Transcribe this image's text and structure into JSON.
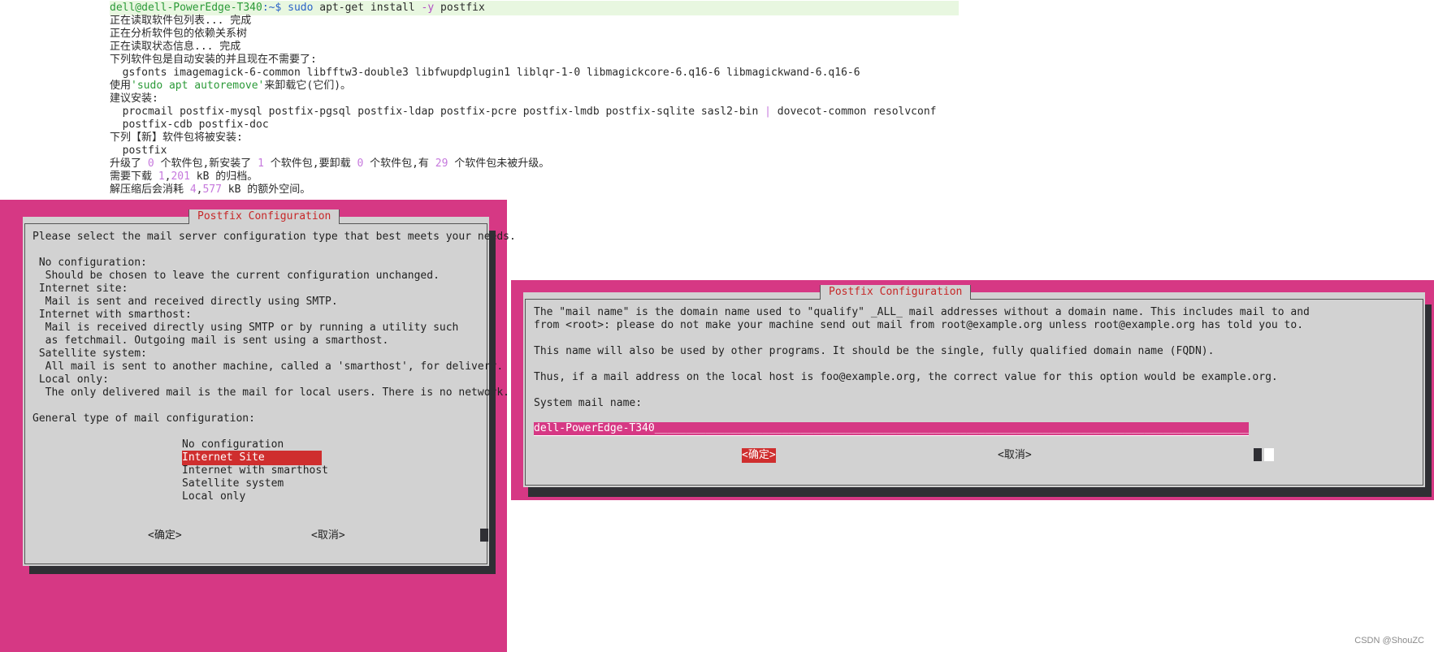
{
  "terminal": {
    "prompt_user": "dell@dell-PowerEdge-T340",
    "prompt_path": ":~$",
    "command_sudo": "sudo",
    "command_rest": " apt-get install ",
    "command_flag": "-y",
    "command_pkg": " postfix",
    "lines": [
      "正在读取软件包列表... 完成",
      "正在分析软件包的依赖关系树",
      "正在读取状态信息... 完成",
      "下列软件包是自动安装的并且现在不需要了:",
      "  gsfonts imagemagick-6-common libfftw3-double3 libfwupdplugin1 liblqr-1-0 libmagickcore-6.q16-6 libmagickwand-6.q16-6"
    ],
    "autoremove_prefix": "使用",
    "autoremove_cmd": "'sudo apt autoremove'",
    "autoremove_suffix": "来卸载它(它们)。",
    "suggest_label": "建议安装:",
    "suggest_line1_a": "  procmail postfix-mysql postfix-pgsql postfix-ldap postfix-pcre postfix-lmdb postfix-sqlite sasl2-bin ",
    "suggest_line1_bar": "|",
    "suggest_line1_b": " dovecot-common resolvconf",
    "suggest_line2": "  postfix-cdb postfix-doc",
    "new_label": "下列【新】软件包将被安装:",
    "new_pkg": "  postfix",
    "upgrade": {
      "t1": "升级了 ",
      "n1": "0",
      "t2": " 个软件包,新安装了 ",
      "n2": "1",
      "t3": " 个软件包,要卸载 ",
      "n3": "0",
      "t4": " 个软件包,有 ",
      "n4": "29",
      "t5": " 个软件包未被升级。"
    },
    "download": {
      "t1": "需要下载 ",
      "n1": "1",
      "sep": ",",
      "n2": "201",
      "t2": " kB 的归档。"
    },
    "space": {
      "t1": "解压缩后会消耗 ",
      "n1": "4",
      "sep": ",",
      "n2": "577",
      "t2": " kB 的额外空间。"
    }
  },
  "dialog1": {
    "title": "Postfix Configuration",
    "lines": [
      "Please select the mail server configuration type that best meets your needs.",
      "",
      " No configuration:",
      "  Should be chosen to leave the current configuration unchanged.",
      " Internet site:",
      "  Mail is sent and received directly using SMTP.",
      " Internet with smarthost:",
      "  Mail is received directly using SMTP or by running a utility such",
      "  as fetchmail. Outgoing mail is sent using a smarthost.",
      " Satellite system:",
      "  All mail is sent to another machine, called a 'smarthost', for delivery.",
      " Local only:",
      "  The only delivered mail is the mail for local users. There is no network.",
      "",
      "General type of mail configuration:"
    ],
    "options": [
      "No configuration",
      "Internet Site",
      "Internet with smarthost",
      "Satellite system",
      "Local only"
    ],
    "selected_index": 1,
    "ok_label": "<确定>",
    "cancel_label": "<取消>"
  },
  "dialog2": {
    "title": "Postfix Configuration",
    "lines": [
      "The \"mail name\" is the domain name used to \"qualify\" _ALL_ mail addresses without a domain name. This includes mail to and",
      "from <root>: please do not make your machine send out mail from root@example.org unless root@example.org has told you to.",
      "",
      "This name will also be used by other programs. It should be the single, fully qualified domain name (FQDN).",
      "",
      "Thus, if a mail address on the local host is foo@example.org, the correct value for this option would be example.org.",
      "",
      "System mail name:"
    ],
    "input_value": "dell-PowerEdge-T340",
    "ok_label": "<确定>",
    "cancel_label": "<取消>"
  },
  "watermark": "CSDN @ShouZC",
  "colors": {
    "dialog_bg": "#d2d2d2",
    "screen_bg": "#d63884",
    "selection": "#cf2e2e",
    "title": "#c62828",
    "shadow": "#2f2f34"
  }
}
